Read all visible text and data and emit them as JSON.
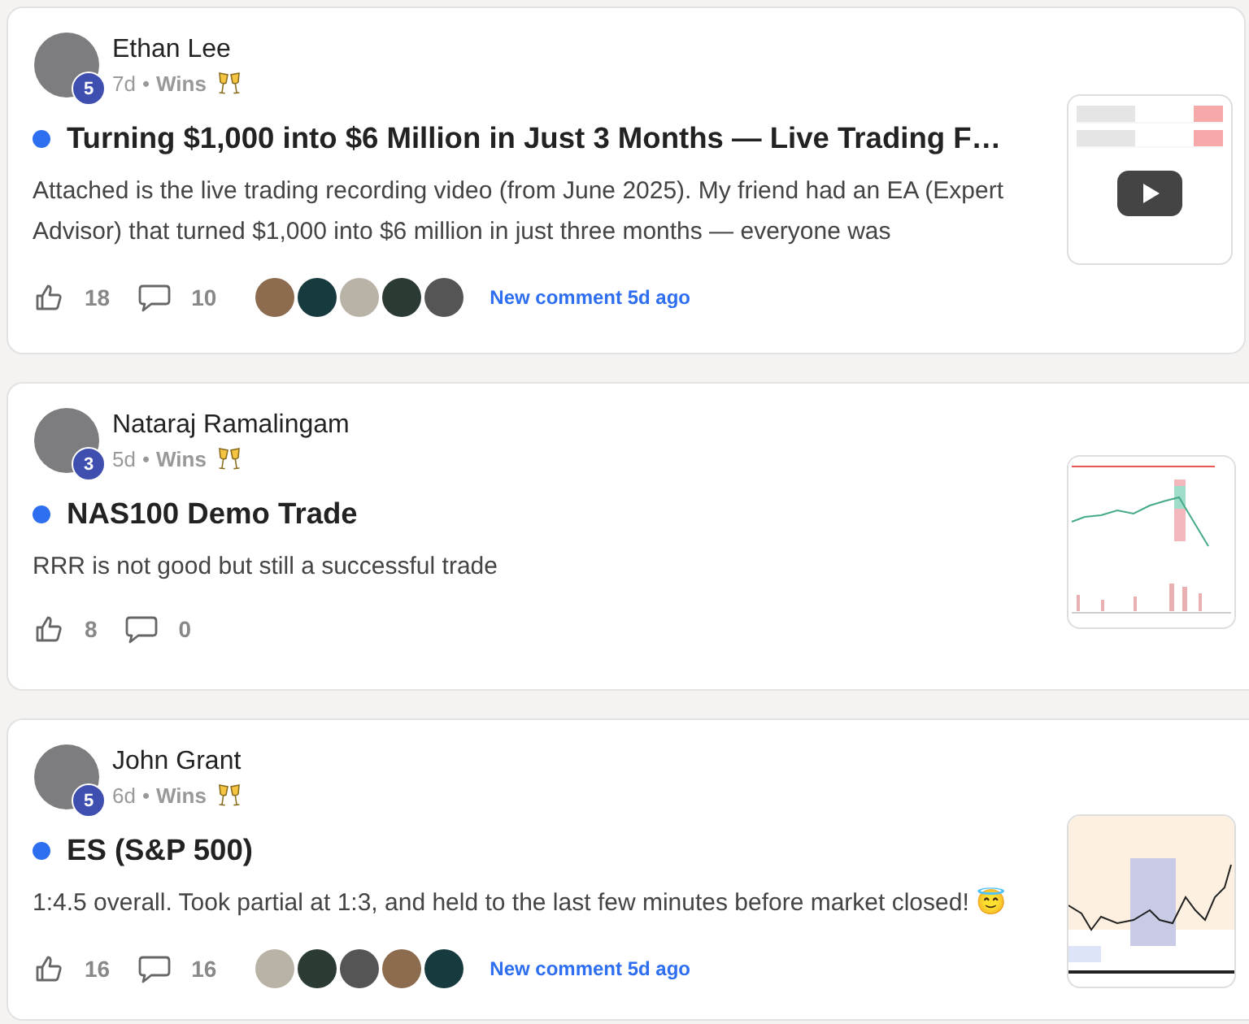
{
  "posts": [
    {
      "author": "Ethan Lee",
      "level": "5",
      "time": "7d",
      "separator": "•",
      "category": "Wins",
      "unread": true,
      "title": "Turning $1,000 into $6 Million in Just 3 Months — Live Trading F…",
      "body": "Attached is the live trading recording video (from June 2025). My friend had an EA (Expert Advisor) that turned $1,000 into $6 million in just three months — everyone was",
      "likes": "18",
      "comments": "10",
      "commenters": [
        {
          "kind": "photo"
        },
        {
          "kind": "photo"
        },
        {
          "kind": "photo"
        },
        {
          "kind": "photo"
        },
        {
          "kind": "photo"
        }
      ],
      "activity": "New comment 5d ago",
      "thumbnail": {
        "kind": "video"
      }
    },
    {
      "author": "Nataraj Ramalingam",
      "level": "3",
      "time": "5d",
      "separator": "•",
      "category": "Wins",
      "unread": true,
      "title": "NAS100 Demo Trade",
      "body": "RRR is not good but still a successful trade",
      "likes": "8",
      "comments": "0",
      "thumbnail": {
        "kind": "chart"
      }
    },
    {
      "author": "John Grant",
      "level": "5",
      "time": "6d",
      "separator": "•",
      "category": "Wins",
      "unread": true,
      "title": "ES (S&P 500)",
      "body": "1:4.5 overall. Took partial at 1:3, and held to the last few minutes before market closed! 😇",
      "likes": "16",
      "comments": "16",
      "commenters": [
        {
          "kind": "photo"
        },
        {
          "kind": "photo"
        },
        {
          "kind": "photo"
        },
        {
          "kind": "photo"
        },
        {
          "kind": "photo"
        }
      ],
      "activity": "New comment 5d ago",
      "thumbnail": {
        "kind": "chart-light"
      }
    }
  ]
}
